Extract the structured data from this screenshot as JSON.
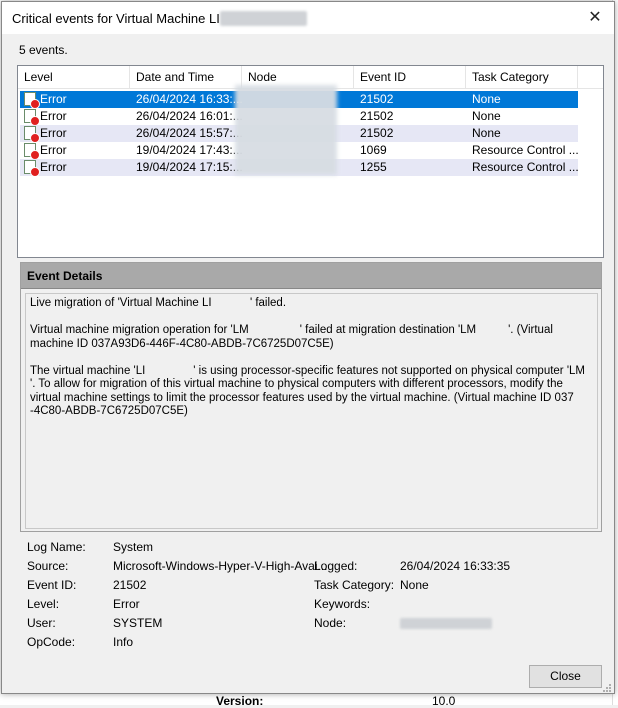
{
  "dialog": {
    "title_prefix": "Critical events for Virtual Machine LI",
    "close_glyph": "✕",
    "event_count": "5 events."
  },
  "columns": [
    "Level",
    "Date and Time",
    "Node",
    "Event ID",
    "Task Category"
  ],
  "events": [
    {
      "level": "Error",
      "datetime": "26/04/2024 16:33:...",
      "node": "",
      "event_id": "21502",
      "category": "None"
    },
    {
      "level": "Error",
      "datetime": "26/04/2024 16:01:...",
      "node": "",
      "event_id": "21502",
      "category": "None"
    },
    {
      "level": "Error",
      "datetime": "26/04/2024 15:57:...",
      "node": "",
      "event_id": "21502",
      "category": "None"
    },
    {
      "level": "Error",
      "datetime": "19/04/2024 17:43:...",
      "node": "",
      "event_id": "1069",
      "category": "Resource Control ..."
    },
    {
      "level": "Error",
      "datetime": "19/04/2024 17:15:...",
      "node": "",
      "event_id": "1255",
      "category": "Resource Control ..."
    }
  ],
  "details": {
    "heading": "Event Details",
    "text": "Live migration of 'Virtual Machine LI            ' failed.\n\nVirtual machine migration operation for 'LM                ' failed at migration destination 'LM          '. (Virtual machine ID 037A93D6-446F-4C80-ABDB-7C6725D07C5E)\n\nThe virtual machine 'LI               ' is using processor-specific features not supported on physical computer 'LM            '. To allow for migration of this virtual machine to physical computers with different processors, modify the virtual machine settings to limit the processor features used by the virtual machine. (Virtual machine ID 037               -4C80-ABDB-7C6725D07C5E)"
  },
  "properties": {
    "log_name_label": "Log Name:",
    "log_name": "System",
    "source_label": "Source:",
    "source": "Microsoft-Windows-Hyper-V-High-Avai...",
    "logged_label": "Logged:",
    "logged": "26/04/2024 16:33:35",
    "event_id_label": "Event ID:",
    "event_id": "21502",
    "task_category_label": "Task Category:",
    "task_category": "None",
    "level_label": "Level:",
    "level": "Error",
    "keywords_label": "Keywords:",
    "keywords": "",
    "user_label": "User:",
    "user": "SYSTEM",
    "node_label": "Node:",
    "node": "",
    "opcode_label": "OpCode:",
    "opcode": "Info"
  },
  "buttons": {
    "close": "Close"
  },
  "background": {
    "version_label": "Version:",
    "version_value": "10.0"
  }
}
